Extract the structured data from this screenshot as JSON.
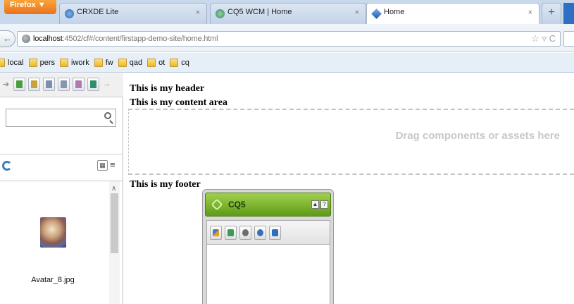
{
  "browser": {
    "menu_button": "Firefox ▼",
    "tabs": [
      {
        "title": "CRXDE Lite",
        "close": "×"
      },
      {
        "title": "CQ5 WCM | Home",
        "close": "×"
      },
      {
        "title": "Home",
        "close": "×"
      }
    ],
    "new_tab": "+",
    "url": {
      "host": "localhost",
      "rest": ":4502/cf#/content/firstapp-demo-site/home.html"
    },
    "url_icons": "☆ ▿ C"
  },
  "bookmarks": [
    {
      "label": "local"
    },
    {
      "label": "pers"
    },
    {
      "label": "iwork"
    },
    {
      "label": "fw"
    },
    {
      "label": "qad"
    },
    {
      "label": "ot"
    },
    {
      "label": "cq"
    }
  ],
  "sidebar": {
    "search_placeholder": "",
    "asset_label": "Avatar_8.jpg"
  },
  "page": {
    "header": "This is my header",
    "content": "This is my content area",
    "dropzone": "Drag components or assets here",
    "footer": "This is my footer"
  },
  "sidekick": {
    "title": "CQ5",
    "collapse": "▲",
    "help": "?"
  },
  "colors": {
    "sidekick_green": "#7ab62d",
    "firefox_orange": "#f08a24"
  }
}
